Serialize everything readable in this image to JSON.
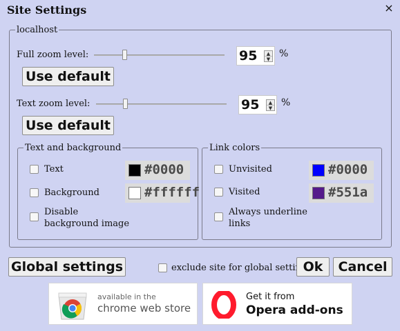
{
  "dialog": {
    "title": "Site Settings",
    "close_glyph": "×"
  },
  "site": {
    "host": "localhost",
    "full_zoom": {
      "label": "Full zoom level:",
      "value": "95",
      "unit": "%",
      "slider_fraction": 0.24,
      "reset_label": "Use default"
    },
    "text_zoom": {
      "label": "Text zoom level:",
      "value": "95",
      "unit": "%",
      "slider_fraction": 0.23,
      "reset_label": "Use default"
    }
  },
  "text_bg": {
    "legend": "Text and background",
    "text": {
      "label": "Text",
      "checked": false,
      "color": "#000000",
      "hex": "#0000"
    },
    "background": {
      "label": "Background",
      "checked": false,
      "color": "#ffffff",
      "hex": "#ffffff"
    },
    "disable_bg_image": {
      "label_line1": "Disable",
      "label_line2": "background image",
      "checked": false
    }
  },
  "links": {
    "legend": "Link colors",
    "unvisited": {
      "label": "Unvisited",
      "checked": false,
      "color": "#0000ff",
      "hex": "#0000"
    },
    "visited": {
      "label": "Visited",
      "checked": false,
      "color": "#551a8b",
      "hex": "#551a"
    },
    "underline": {
      "label_line1": "Always underline",
      "label_line2": "links",
      "checked": false
    }
  },
  "footer": {
    "global_settings_label": "Global settings",
    "exclude_label": "exclude site for global settings",
    "exclude_checked": false,
    "ok_label": "Ok",
    "cancel_label": "Cancel"
  },
  "stores": {
    "chrome": {
      "line1": "available in the",
      "line2": "chrome web store",
      "icon": "chrome-web-store-icon"
    },
    "opera": {
      "line1": "Get it from",
      "line2": "Opera add-ons",
      "icon": "opera-icon",
      "brand_color": "#ff1b2d"
    }
  }
}
